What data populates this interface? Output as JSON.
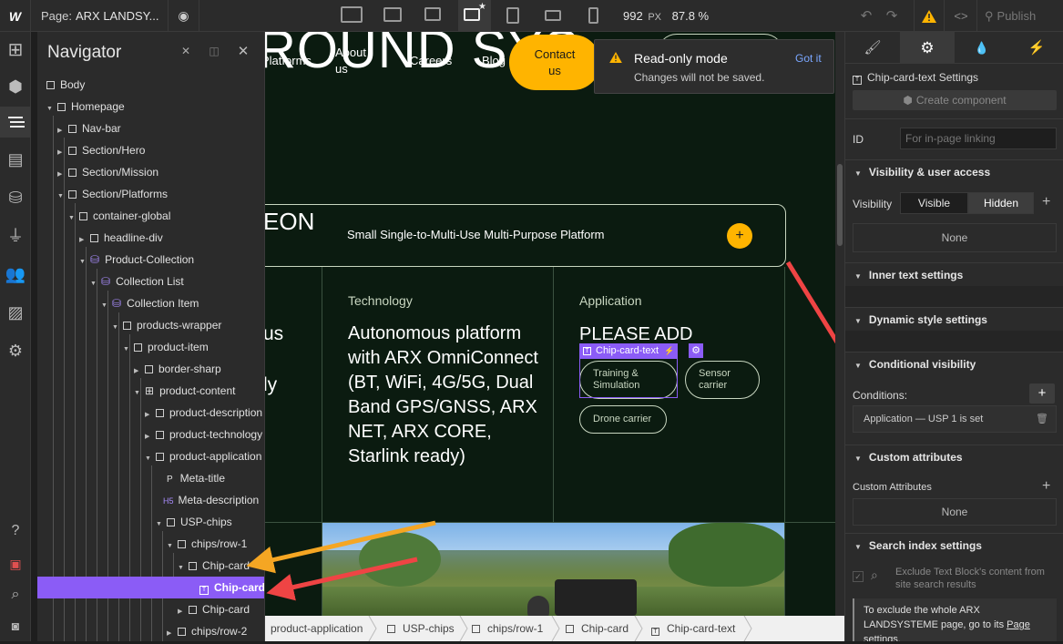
{
  "topbar": {
    "logo": "W",
    "page_label": "Page:",
    "page_name": "ARX LANDSY...",
    "width_value": "992",
    "width_unit": "PX",
    "zoom": "87.8 %",
    "publish_label": "Publish"
  },
  "navigator": {
    "title": "Navigator",
    "items": [
      {
        "label": "Body"
      },
      {
        "label": "Homepage"
      },
      {
        "label": "Nav-bar"
      },
      {
        "label": "Section/Hero"
      },
      {
        "label": "Section/Mission"
      },
      {
        "label": "Section/Platforms"
      },
      {
        "label": "container-global"
      },
      {
        "label": "headline-div"
      },
      {
        "label": "Product-Collection"
      },
      {
        "label": "Collection List"
      },
      {
        "label": "Collection Item"
      },
      {
        "label": "products-wrapper"
      },
      {
        "label": "product-item"
      },
      {
        "label": "border-sharp"
      },
      {
        "label": "product-content"
      },
      {
        "label": "product-description"
      },
      {
        "label": "product-technology"
      },
      {
        "label": "product-application"
      },
      {
        "label": "Meta-title",
        "badge": "P"
      },
      {
        "label": "Meta-description",
        "badge": "H5"
      },
      {
        "label": "USP-chips"
      },
      {
        "label": "chips/row-1"
      },
      {
        "label": "Chip-card"
      },
      {
        "label": "Chip-card."
      },
      {
        "label": "Chip-card"
      },
      {
        "label": "chips/row-2"
      }
    ]
  },
  "canvas": {
    "hero_title": "ROUND SYS",
    "nav_links": [
      "Platforms",
      "About us",
      "Careers",
      "Blog"
    ],
    "contact_btn": "Contact us",
    "toast": {
      "title": "Read-only mode",
      "message": "Changes will not be saved.",
      "action": "Got it"
    },
    "product_name": "EON",
    "product_tagline": "Small Single-to-Multi-Use Multi-Purpose Platform",
    "left_col_fragment_1": "us",
    "left_col_fragment_2": "ly",
    "technology_label": "Technology",
    "technology_text": "Autonomous platform with ARX OmniConnect (BT, WiFi, 4G/5G, Dual Band GPS/GNSS, ARX NET, ARX CORE, Starlink ready)",
    "application_label": "Application",
    "application_title": "PLEASE ADD",
    "selection_tag": "Chip-card-text",
    "chips": [
      "Training & Simulation",
      "Sensor carrier",
      "Drone carrier"
    ]
  },
  "breadcrumbs": [
    "product-application",
    "USP-chips",
    "chips/row-1",
    "Chip-card",
    "Chip-card-text"
  ],
  "right_panel": {
    "element_settings_title": "Chip-card-text Settings",
    "create_component": "Create component",
    "id_label": "ID",
    "id_placeholder": "For in-page linking",
    "sections": {
      "visibility": "Visibility & user access",
      "inner_text": "Inner text settings",
      "dynamic_style": "Dynamic style settings",
      "conditional": "Conditional visibility",
      "custom_attributes": "Custom attributes",
      "search_index": "Search index settings"
    },
    "visibility_label": "Visibility",
    "visible_btn": "Visible",
    "hidden_btn": "Hidden",
    "none_1": "None",
    "conditions_label": "Conditions:",
    "condition_item": "Application — USP 1 is set",
    "custom_attributes_label": "Custom Attributes",
    "none_2": "None",
    "exclude_text": "Exclude Text Block's content from site search results",
    "exclude_note": "To exclude the whole ARX LANDSYSTEME page, go to its",
    "page_link": "Page",
    "settings_word": "settings."
  },
  "colors": {
    "accent_purple": "#8b5cf6",
    "accent_yellow": "#ffb400",
    "canvas_bg": "#0b1b10",
    "arrow_red": "#ef4444",
    "arrow_orange": "#f5a623"
  }
}
